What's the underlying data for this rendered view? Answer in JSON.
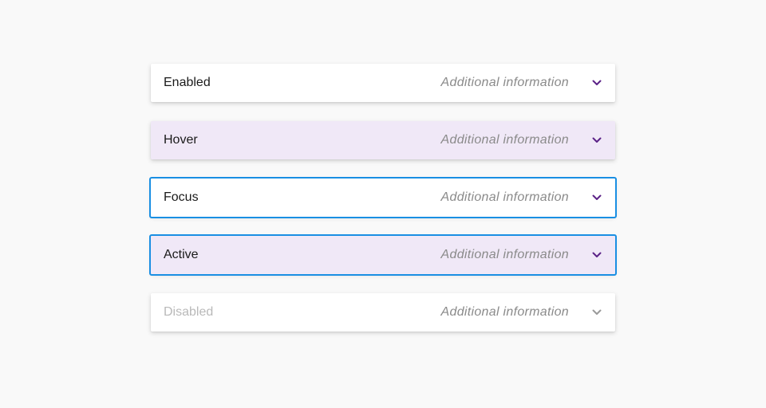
{
  "panels": [
    {
      "label": "Enabled",
      "info": "Additional information",
      "state": "enabled",
      "chevron_icon": "chevron-down-icon"
    },
    {
      "label": "Hover",
      "info": "Additional information",
      "state": "hover",
      "chevron_icon": "chevron-down-icon"
    },
    {
      "label": "Focus",
      "info": "Additional information",
      "state": "focus",
      "chevron_icon": "chevron-down-icon"
    },
    {
      "label": "Active",
      "info": "Additional information",
      "state": "active",
      "chevron_icon": "chevron-down-icon"
    },
    {
      "label": "Disabled",
      "info": "Additional information",
      "state": "disabled",
      "chevron_icon": "chevron-down-icon"
    }
  ],
  "colors": {
    "background": "#f9f9f9",
    "panel": "#ffffff",
    "hover_tint": "#f0e8f7",
    "focus_border": "#1a8fe3",
    "chevron": "#5b2287",
    "chevron_disabled": "#9a9a9a",
    "label": "#1a1a1a",
    "label_disabled": "#b9b9b9",
    "info": "#8a8a8a"
  }
}
